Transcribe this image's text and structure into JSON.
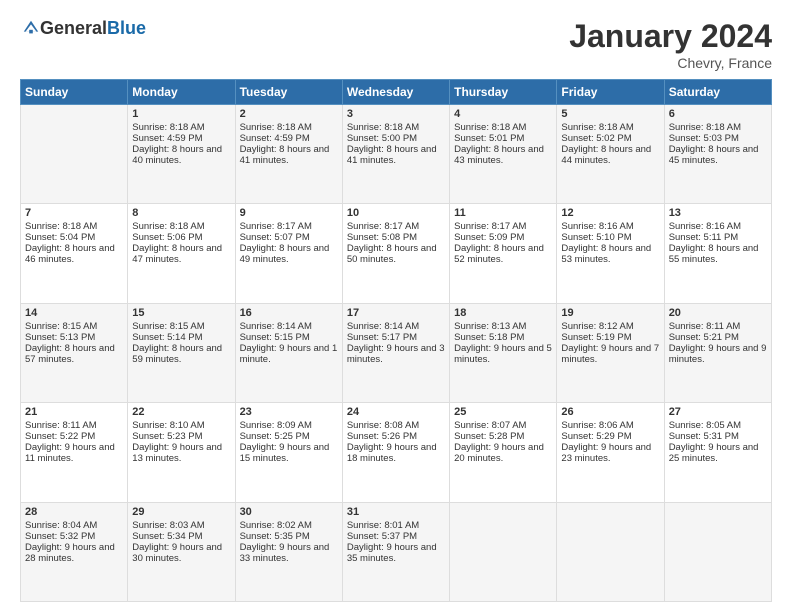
{
  "header": {
    "logo_general": "General",
    "logo_blue": "Blue",
    "month_title": "January 2024",
    "subtitle": "Chevry, France"
  },
  "weekdays": [
    "Sunday",
    "Monday",
    "Tuesday",
    "Wednesday",
    "Thursday",
    "Friday",
    "Saturday"
  ],
  "weeks": [
    [
      {
        "day": "",
        "sunrise": "",
        "sunset": "",
        "daylight": ""
      },
      {
        "day": "1",
        "sunrise": "Sunrise: 8:18 AM",
        "sunset": "Sunset: 4:59 PM",
        "daylight": "Daylight: 8 hours and 40 minutes."
      },
      {
        "day": "2",
        "sunrise": "Sunrise: 8:18 AM",
        "sunset": "Sunset: 4:59 PM",
        "daylight": "Daylight: 8 hours and 41 minutes."
      },
      {
        "day": "3",
        "sunrise": "Sunrise: 8:18 AM",
        "sunset": "Sunset: 5:00 PM",
        "daylight": "Daylight: 8 hours and 41 minutes."
      },
      {
        "day": "4",
        "sunrise": "Sunrise: 8:18 AM",
        "sunset": "Sunset: 5:01 PM",
        "daylight": "Daylight: 8 hours and 43 minutes."
      },
      {
        "day": "5",
        "sunrise": "Sunrise: 8:18 AM",
        "sunset": "Sunset: 5:02 PM",
        "daylight": "Daylight: 8 hours and 44 minutes."
      },
      {
        "day": "6",
        "sunrise": "Sunrise: 8:18 AM",
        "sunset": "Sunset: 5:03 PM",
        "daylight": "Daylight: 8 hours and 45 minutes."
      }
    ],
    [
      {
        "day": "7",
        "sunrise": "Sunrise: 8:18 AM",
        "sunset": "Sunset: 5:04 PM",
        "daylight": "Daylight: 8 hours and 46 minutes."
      },
      {
        "day": "8",
        "sunrise": "Sunrise: 8:18 AM",
        "sunset": "Sunset: 5:06 PM",
        "daylight": "Daylight: 8 hours and 47 minutes."
      },
      {
        "day": "9",
        "sunrise": "Sunrise: 8:17 AM",
        "sunset": "Sunset: 5:07 PM",
        "daylight": "Daylight: 8 hours and 49 minutes."
      },
      {
        "day": "10",
        "sunrise": "Sunrise: 8:17 AM",
        "sunset": "Sunset: 5:08 PM",
        "daylight": "Daylight: 8 hours and 50 minutes."
      },
      {
        "day": "11",
        "sunrise": "Sunrise: 8:17 AM",
        "sunset": "Sunset: 5:09 PM",
        "daylight": "Daylight: 8 hours and 52 minutes."
      },
      {
        "day": "12",
        "sunrise": "Sunrise: 8:16 AM",
        "sunset": "Sunset: 5:10 PM",
        "daylight": "Daylight: 8 hours and 53 minutes."
      },
      {
        "day": "13",
        "sunrise": "Sunrise: 8:16 AM",
        "sunset": "Sunset: 5:11 PM",
        "daylight": "Daylight: 8 hours and 55 minutes."
      }
    ],
    [
      {
        "day": "14",
        "sunrise": "Sunrise: 8:15 AM",
        "sunset": "Sunset: 5:13 PM",
        "daylight": "Daylight: 8 hours and 57 minutes."
      },
      {
        "day": "15",
        "sunrise": "Sunrise: 8:15 AM",
        "sunset": "Sunset: 5:14 PM",
        "daylight": "Daylight: 8 hours and 59 minutes."
      },
      {
        "day": "16",
        "sunrise": "Sunrise: 8:14 AM",
        "sunset": "Sunset: 5:15 PM",
        "daylight": "Daylight: 9 hours and 1 minute."
      },
      {
        "day": "17",
        "sunrise": "Sunrise: 8:14 AM",
        "sunset": "Sunset: 5:17 PM",
        "daylight": "Daylight: 9 hours and 3 minutes."
      },
      {
        "day": "18",
        "sunrise": "Sunrise: 8:13 AM",
        "sunset": "Sunset: 5:18 PM",
        "daylight": "Daylight: 9 hours and 5 minutes."
      },
      {
        "day": "19",
        "sunrise": "Sunrise: 8:12 AM",
        "sunset": "Sunset: 5:19 PM",
        "daylight": "Daylight: 9 hours and 7 minutes."
      },
      {
        "day": "20",
        "sunrise": "Sunrise: 8:11 AM",
        "sunset": "Sunset: 5:21 PM",
        "daylight": "Daylight: 9 hours and 9 minutes."
      }
    ],
    [
      {
        "day": "21",
        "sunrise": "Sunrise: 8:11 AM",
        "sunset": "Sunset: 5:22 PM",
        "daylight": "Daylight: 9 hours and 11 minutes."
      },
      {
        "day": "22",
        "sunrise": "Sunrise: 8:10 AM",
        "sunset": "Sunset: 5:23 PM",
        "daylight": "Daylight: 9 hours and 13 minutes."
      },
      {
        "day": "23",
        "sunrise": "Sunrise: 8:09 AM",
        "sunset": "Sunset: 5:25 PM",
        "daylight": "Daylight: 9 hours and 15 minutes."
      },
      {
        "day": "24",
        "sunrise": "Sunrise: 8:08 AM",
        "sunset": "Sunset: 5:26 PM",
        "daylight": "Daylight: 9 hours and 18 minutes."
      },
      {
        "day": "25",
        "sunrise": "Sunrise: 8:07 AM",
        "sunset": "Sunset: 5:28 PM",
        "daylight": "Daylight: 9 hours and 20 minutes."
      },
      {
        "day": "26",
        "sunrise": "Sunrise: 8:06 AM",
        "sunset": "Sunset: 5:29 PM",
        "daylight": "Daylight: 9 hours and 23 minutes."
      },
      {
        "day": "27",
        "sunrise": "Sunrise: 8:05 AM",
        "sunset": "Sunset: 5:31 PM",
        "daylight": "Daylight: 9 hours and 25 minutes."
      }
    ],
    [
      {
        "day": "28",
        "sunrise": "Sunrise: 8:04 AM",
        "sunset": "Sunset: 5:32 PM",
        "daylight": "Daylight: 9 hours and 28 minutes."
      },
      {
        "day": "29",
        "sunrise": "Sunrise: 8:03 AM",
        "sunset": "Sunset: 5:34 PM",
        "daylight": "Daylight: 9 hours and 30 minutes."
      },
      {
        "day": "30",
        "sunrise": "Sunrise: 8:02 AM",
        "sunset": "Sunset: 5:35 PM",
        "daylight": "Daylight: 9 hours and 33 minutes."
      },
      {
        "day": "31",
        "sunrise": "Sunrise: 8:01 AM",
        "sunset": "Sunset: 5:37 PM",
        "daylight": "Daylight: 9 hours and 35 minutes."
      },
      {
        "day": "",
        "sunrise": "",
        "sunset": "",
        "daylight": ""
      },
      {
        "day": "",
        "sunrise": "",
        "sunset": "",
        "daylight": ""
      },
      {
        "day": "",
        "sunrise": "",
        "sunset": "",
        "daylight": ""
      }
    ]
  ]
}
